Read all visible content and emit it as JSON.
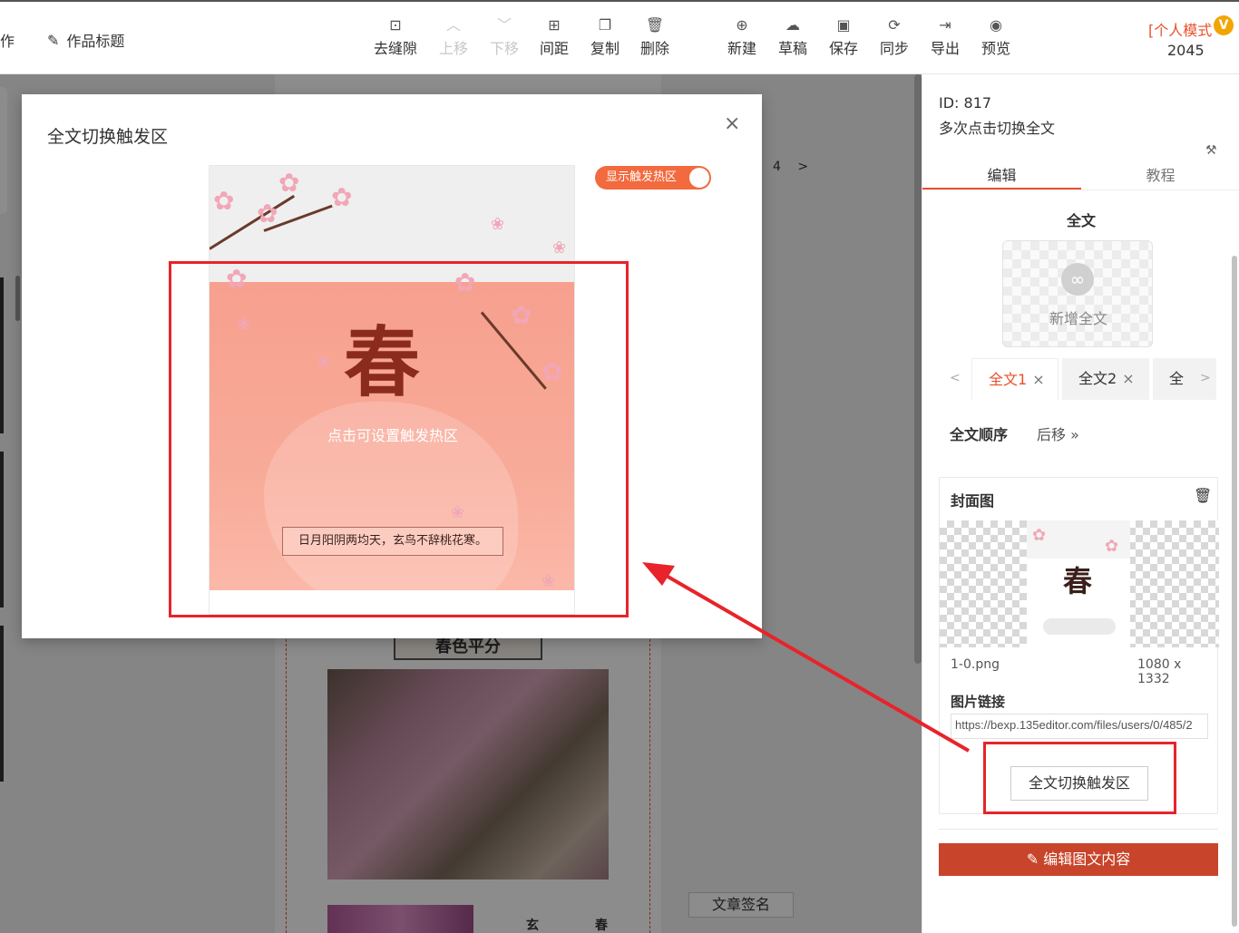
{
  "toolbar": {
    "left_cut_label": "作",
    "title_label": "作品标题",
    "buttons": [
      {
        "icon": "remove-gap-icon",
        "label": "去缝隙",
        "enabled": true
      },
      {
        "icon": "up-icon",
        "label": "上移",
        "enabled": false
      },
      {
        "icon": "down-icon",
        "label": "下移",
        "enabled": false
      },
      {
        "icon": "spacing-icon",
        "label": "间距",
        "enabled": true
      },
      {
        "icon": "copy-icon",
        "label": "复制",
        "enabled": true
      },
      {
        "icon": "delete-icon",
        "label": "删除",
        "enabled": true
      },
      {
        "icon": "new-icon",
        "label": "新建",
        "enabled": true
      },
      {
        "icon": "draft-icon",
        "label": "草稿",
        "enabled": true
      },
      {
        "icon": "save-icon",
        "label": "保存",
        "enabled": true
      },
      {
        "icon": "sync-icon",
        "label": "同步",
        "enabled": true
      },
      {
        "icon": "export-icon",
        "label": "导出",
        "enabled": true
      },
      {
        "icon": "preview-icon",
        "label": "预览",
        "enabled": true
      }
    ],
    "mode_label": "[个人模式",
    "vip_badge": "V",
    "count": "2045"
  },
  "editor": {
    "page_indicator": "4",
    "next_arrow": ">",
    "section_title": "春色平分",
    "vertical_text_1": "玄",
    "vertical_text_2": "春",
    "sign_button": "文章签名"
  },
  "modal": {
    "title": "全文切换触发区",
    "close_icon": "×",
    "toggle_label": "显示触发热区",
    "toggle_on": true,
    "preview": {
      "big_char": "春",
      "hint": "点击可设置触发热区",
      "motto": "日月阳阴两均天，玄鸟不辞桃花寒。"
    }
  },
  "right_panel": {
    "id_label": "ID: 817",
    "name": "多次点击切换全文",
    "tabs": [
      {
        "label": "编辑",
        "active": true
      },
      {
        "label": "教程",
        "active": false
      }
    ],
    "section_title": "全文",
    "add_label": "新增全文",
    "subtabs": [
      {
        "label": "全文1",
        "close": "×",
        "active": true
      },
      {
        "label": "全文2",
        "close": "×",
        "active": false
      },
      {
        "label": "全",
        "close": "",
        "active": false
      }
    ],
    "prev_arrow": "<",
    "next_arrow": ">",
    "order_label": "全文顺序",
    "next_label": "后移 »",
    "cover": {
      "title": "封面图",
      "thumb_char": "春",
      "filename": "1-0.png",
      "size": "1080 x 1332",
      "link_label": "图片链接",
      "link_value": "https://bexp.135editor.com/files/users/0/485/2"
    },
    "switch_button": "全文切换触发区",
    "edit_button": "编辑图文内容"
  },
  "colors": {
    "accent": "#e8502b",
    "annotation_red": "#e8232a",
    "edit_button": "#c8442a",
    "toggle": "#f26a3e"
  }
}
